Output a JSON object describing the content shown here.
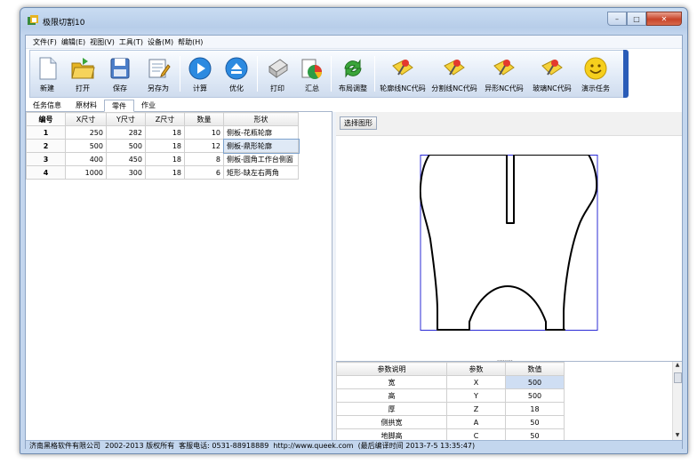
{
  "window": {
    "title": "极限切割10",
    "minimize": "–",
    "maximize": "□",
    "close": "✕"
  },
  "menu": [
    "文件(F)",
    "编辑(E)",
    "视图(V)",
    "工具(T)",
    "设备(M)",
    "帮助(H)"
  ],
  "toolbar": {
    "new": "新建",
    "open": "打开",
    "save": "保存",
    "save_as": "另存为",
    "calc": "计算",
    "optimize": "优化",
    "print": "打印",
    "summary": "汇总",
    "layout_adjust": "布局调整",
    "contour_nc": "轮廓线NC代码",
    "split_nc": "分割线NC代码",
    "shaped_nc": "异形NC代码",
    "glass_nc": "玻璃NC代码",
    "demo_task": "演示任务"
  },
  "tabs": [
    "任务信息",
    "原材料",
    "零件",
    "作业"
  ],
  "active_tab": "零件",
  "parts_table": {
    "headers": [
      "编号",
      "X尺寸",
      "Y尺寸",
      "Z尺寸",
      "数量",
      "形状"
    ],
    "rows": [
      [
        "1",
        "250",
        "282",
        "18",
        "10",
        "侧板-花瓶轮廓"
      ],
      [
        "2",
        "500",
        "500",
        "18",
        "12",
        "侧板-鼎形轮廓"
      ],
      [
        "3",
        "400",
        "450",
        "18",
        "8",
        "侧板-圆角工作台侧面"
      ],
      [
        "4",
        "1000",
        "300",
        "18",
        "6",
        "矩形-缺左右两角"
      ]
    ],
    "selected_row": 2
  },
  "select_shape_button": "选择图形",
  "params_table": {
    "headers": [
      "参数说明",
      "参数",
      "数值"
    ],
    "rows": [
      [
        "宽",
        "X",
        "500"
      ],
      [
        "高",
        "Y",
        "500"
      ],
      [
        "厚",
        "Z",
        "18"
      ],
      [
        "侧拱宽",
        "A",
        "50"
      ],
      [
        "地脚高",
        "C",
        "50"
      ]
    ],
    "selected_row": 1
  },
  "status": {
    "company": "济南黑格软件有限公司",
    "copyright": "2002-2013 版权所有",
    "phone": "客服电话: 0531-88918889",
    "url": "http://www.queek.com",
    "compile_time": "(最后编译时间 2013-7-5 13:35:47)"
  },
  "colors": {
    "accent": "#2a5cb8",
    "selection": "#cfdef3",
    "bounding_box": "#2b2bd6"
  },
  "icons": [
    "app-icon",
    "new-file-icon",
    "open-folder-icon",
    "save-disk-icon",
    "save-as-icon",
    "play-icon",
    "eject-icon",
    "printer-icon",
    "chart-icon",
    "refresh-icon",
    "nc-code-icon",
    "smiley-icon"
  ]
}
